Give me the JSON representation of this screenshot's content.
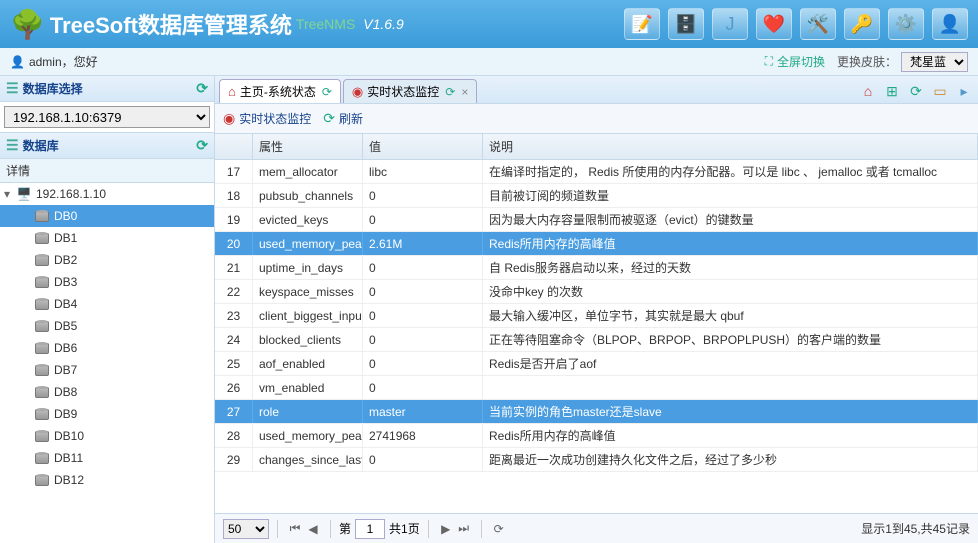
{
  "brand": {
    "title": "TreeSoft数据库管理系统",
    "sub": "TreeNMS",
    "version": "V1.6.9"
  },
  "user": {
    "greeting": "admin，您好"
  },
  "controls": {
    "fullscreen": "全屏切换",
    "skin_label": "更换皮肤：",
    "skin_value": "梵星蓝"
  },
  "left": {
    "panel1": "数据库选择",
    "server": "192.168.1.10:6379",
    "panel2": "数据库",
    "detail": "详情",
    "root": "192.168.1.10",
    "dbs": [
      "DB0",
      "DB1",
      "DB2",
      "DB3",
      "DB4",
      "DB5",
      "DB6",
      "DB7",
      "DB8",
      "DB9",
      "DB10",
      "DB11",
      "DB12"
    ],
    "selected": 0
  },
  "tabs": {
    "t1": "主页-系统状态",
    "t2": "实时状态监控"
  },
  "toolbar": {
    "monitor": "实时状态监控",
    "refresh": "刷新"
  },
  "grid": {
    "cols": [
      "",
      "属性",
      "值",
      "说明"
    ],
    "selected": [
      3,
      10
    ],
    "rows": [
      {
        "n": "17",
        "p": "mem_allocator",
        "v": "libc",
        "d": "在编译时指定的， Redis 所使用的内存分配器。可以是 libc 、 jemalloc 或者 tcmalloc"
      },
      {
        "n": "18",
        "p": "pubsub_channels",
        "v": "0",
        "d": "目前被订阅的频道数量"
      },
      {
        "n": "19",
        "p": "evicted_keys",
        "v": "0",
        "d": "因为最大内存容量限制而被驱逐（evict）的键数量"
      },
      {
        "n": "20",
        "p": "used_memory_peak",
        "v": "2.61M",
        "d": "Redis所用内存的高峰值"
      },
      {
        "n": "21",
        "p": "uptime_in_days",
        "v": "0",
        "d": "自 Redis服务器启动以来，经过的天数"
      },
      {
        "n": "22",
        "p": "keyspace_misses",
        "v": "0",
        "d": "没命中key 的次数"
      },
      {
        "n": "23",
        "p": "client_biggest_input",
        "v": "0",
        "d": "最大输入缓冲区，单位字节，其实就是最大 qbuf"
      },
      {
        "n": "24",
        "p": "blocked_clients",
        "v": "0",
        "d": "正在等待阻塞命令（BLPOP、BRPOP、BRPOPLPUSH）的客户端的数量"
      },
      {
        "n": "25",
        "p": "aof_enabled",
        "v": "0",
        "d": "Redis是否开启了aof"
      },
      {
        "n": "26",
        "p": "vm_enabled",
        "v": "0",
        "d": ""
      },
      {
        "n": "27",
        "p": "role",
        "v": "master",
        "d": "当前实例的角色master还是slave"
      },
      {
        "n": "28",
        "p": "used_memory_peak",
        "v": "2741968",
        "d": "Redis所用内存的高峰值"
      },
      {
        "n": "29",
        "p": "changes_since_last",
        "v": "0",
        "d": "距离最近一次成功创建持久化文件之后，经过了多少秒"
      }
    ]
  },
  "pager": {
    "size": "50",
    "page_label_pre": "第",
    "page": "1",
    "page_label_post": "共1页",
    "info": "显示1到45,共45记录"
  }
}
